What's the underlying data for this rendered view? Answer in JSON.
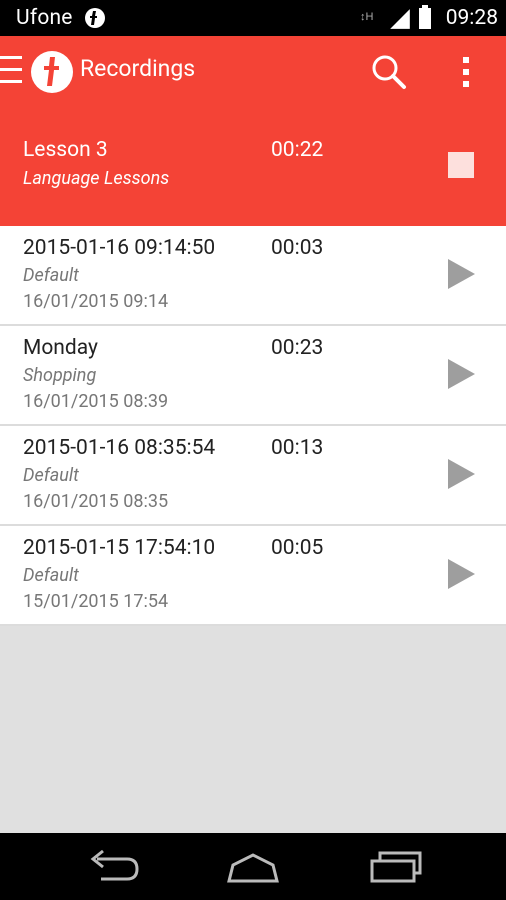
{
  "status_bar": {
    "carrier": "Ufone",
    "time": "09:28",
    "icons": [
      "ufone-logo-icon",
      "data-h-icon",
      "signal-icon",
      "battery-icon"
    ]
  },
  "app_bar": {
    "title": "Recordings",
    "icons": [
      "drawer-menu-icon",
      "app-logo-icon",
      "search-icon",
      "overflow-menu-icon"
    ]
  },
  "now_playing": {
    "title": "Lesson 3",
    "duration": "00:22",
    "category": "Language Lessons",
    "control": "stop-icon"
  },
  "recordings": [
    {
      "title": "2015-01-16 09:14:50",
      "duration": "00:03",
      "category": "Default",
      "date": "16/01/2015 09:14"
    },
    {
      "title": "Monday",
      "duration": "00:23",
      "category": "Shopping",
      "date": "16/01/2015 08:39"
    },
    {
      "title": "2015-01-16 08:35:54",
      "duration": "00:13",
      "category": "Default",
      "date": "16/01/2015 08:35"
    },
    {
      "title": "2015-01-15 17:54:10",
      "duration": "00:05",
      "category": "Default",
      "date": "15/01/2015 17:54"
    }
  ],
  "nav_bar": {
    "icons": [
      "back-icon",
      "home-icon",
      "recents-icon"
    ]
  },
  "colors": {
    "accent": "#f44336",
    "stop_fill": "#fde0dd",
    "play_icon": "#9e9e9e",
    "empty_area": "#e0e0e0"
  }
}
